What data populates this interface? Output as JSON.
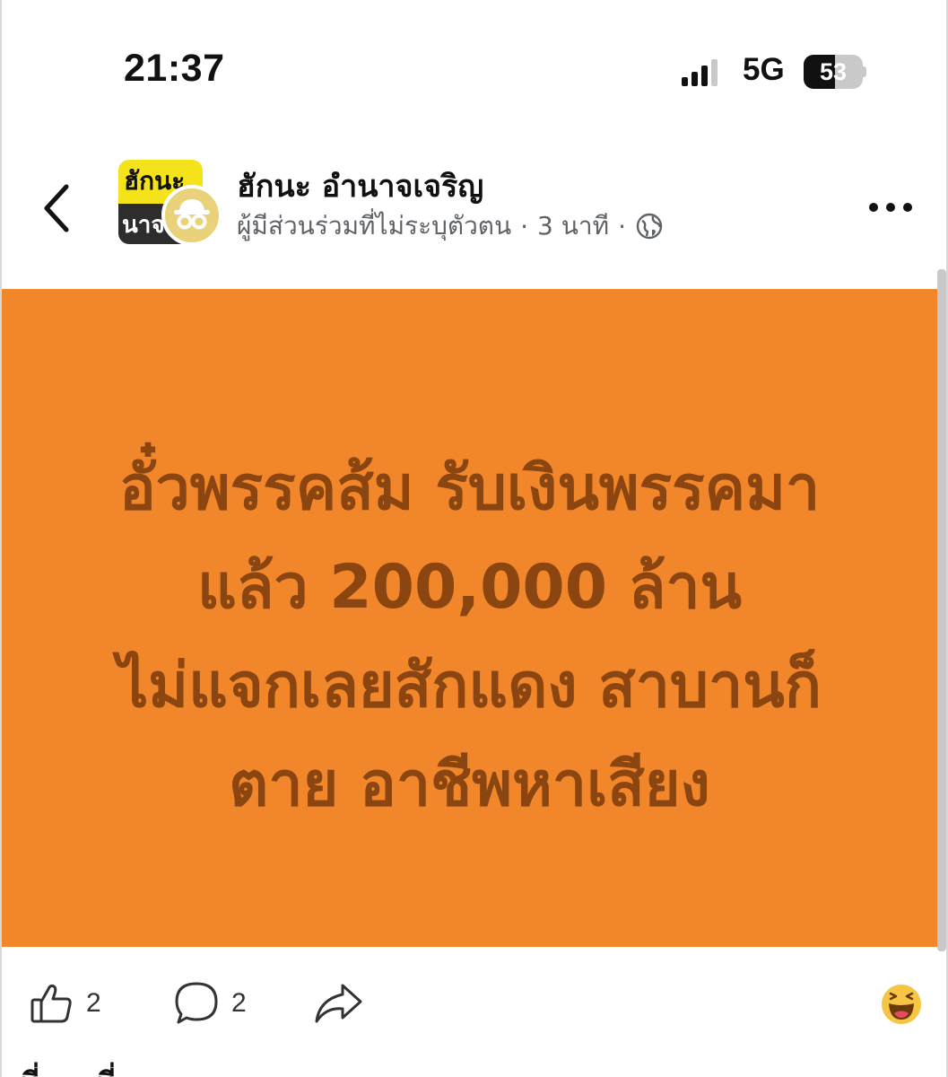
{
  "status_bar": {
    "time": "21:37",
    "network": "5G",
    "battery": 53,
    "battery_label": "53"
  },
  "post": {
    "group_name": "ฮักนะ อำนาจเจริญ",
    "group_logo_line1": "ฮักนะ",
    "group_logo_line2": "นาจ",
    "author_label": "ผู้มีส่วนร่วมที่ไม่ระบุตัวตน",
    "time_ago": "3 นาที",
    "dot": "·",
    "body_lines": [
      "อั๋วพรรคส้ม รับเงินพรรคมา",
      "แล้ว 200,000 ล้าน",
      "ไม่แจกเลยสักแดง สาบานก็",
      "ตาย อาชีพหาเสียง"
    ],
    "background_color": "#f2862a",
    "text_color": "#8a4510"
  },
  "actions": {
    "like_count": "2",
    "comment_count": "2"
  },
  "icons": {
    "back": "chevron-left-icon",
    "more": "more-dots-icon",
    "globe": "globe-icon",
    "like": "thumbs-up-icon",
    "comment": "comment-icon",
    "share": "share-icon",
    "anonymous": "anonymous-icon",
    "reaction": "emoji-haha-icon"
  },
  "footer_partial_text": "ที่ ... ที่"
}
